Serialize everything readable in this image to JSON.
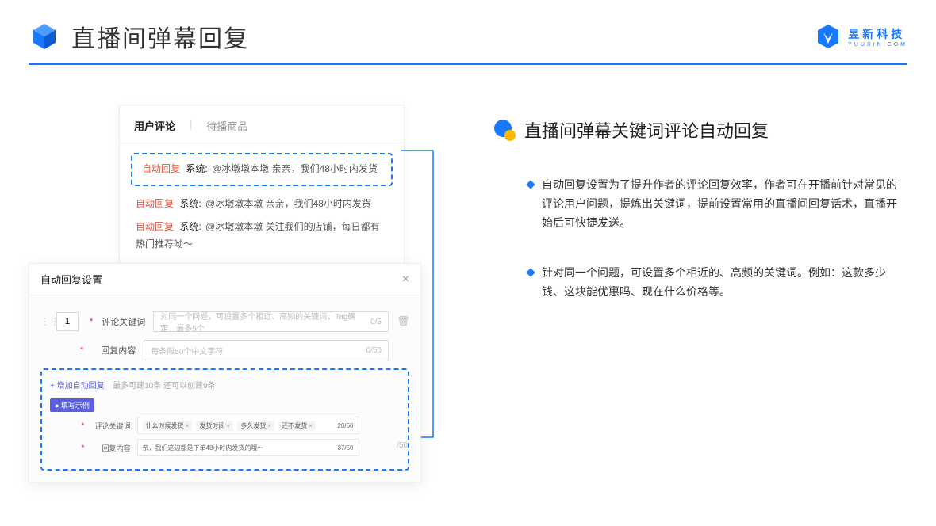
{
  "header": {
    "title": "直播间弹幕回复",
    "logo_cn": "昱新科技",
    "logo_en": "YUUXIN.COM"
  },
  "comments": {
    "tabs": {
      "active": "用户评论",
      "inactive": "待播商品"
    },
    "highlighted": {
      "prefix": "自动回复",
      "system": "系统:",
      "text": "@冰墩墩本墩 亲亲，我们48小时内发货"
    },
    "items": [
      {
        "prefix": "自动回复",
        "system": "系统:",
        "text": "@冰墩墩本墩 亲亲，我们48小时内发货"
      },
      {
        "prefix": "自动回复",
        "system": "系统:",
        "text": "@冰墩墩本墩 关注我们的店铺，每日都有热门推荐呦～"
      }
    ]
  },
  "settings": {
    "title": "自动回复设置",
    "sequence": "1",
    "fields": {
      "keyword_label": "评论关键词",
      "keyword_placeholder": "对同一个问题，可设置多个相近、高频的关键词，Tag确定，最多5个",
      "keyword_counter": "0/5",
      "content_label": "回复内容",
      "content_placeholder": "每条限50个中文字符",
      "content_counter": "0/50"
    },
    "add_link": "+ 增加自动回复",
    "add_hint": "最多可建10条 还可以创建9条",
    "example_badge": "● 填写示例",
    "example": {
      "keyword_label": "评论关键词",
      "tags": [
        "什么时候发货",
        "发货时间",
        "多久发货",
        "还不发货"
      ],
      "keyword_counter": "20/50",
      "content_label": "回复内容",
      "content_value": "亲，我们这边都是下单48小时内发货的哦～",
      "content_counter": "37/50"
    },
    "stray_counter": "/50"
  },
  "side": {
    "title": "直播间弹幕关键词评论自动回复",
    "bullets": [
      "自动回复设置为了提升作者的评论回复效率，作者可在开播前针对常见的评论用户问题，提炼出关键词，提前设置常用的直播间回复话术，直播开始后可快捷发送。",
      "针对同一个问题，可设置多个相近的、高频的关键词。例如：这款多少钱、这块能优惠吗、现在什么价格等。"
    ]
  }
}
